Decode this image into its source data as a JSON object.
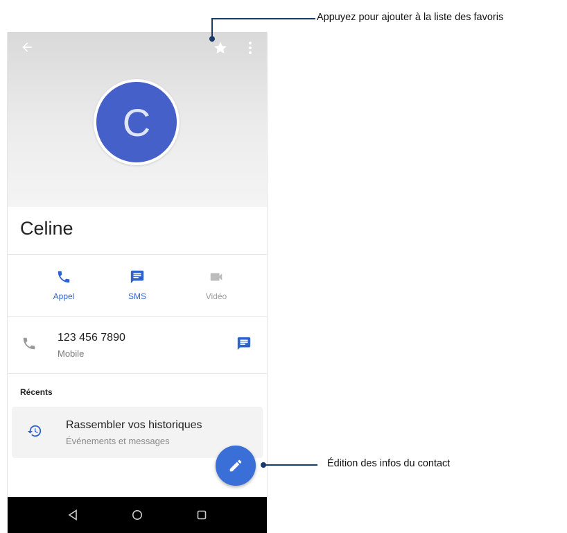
{
  "contact": {
    "avatar_letter": "C",
    "name": "Celine"
  },
  "actions": [
    {
      "label": "Appel",
      "icon": "phone-icon"
    },
    {
      "label": "SMS",
      "icon": "message-icon"
    },
    {
      "label": "Vidéo",
      "icon": "video-icon"
    }
  ],
  "phone": {
    "number": "123 456 7890",
    "type": "Mobile"
  },
  "recents": {
    "title": "Récents",
    "card_title": "Rassembler vos historiques",
    "card_subtitle": "Événements et messages"
  },
  "annotations": {
    "favorites": "Appuyez pour ajouter à la liste des favoris",
    "edit": "Édition des infos du contact"
  },
  "colors": {
    "accent": "#3b6fd8",
    "avatar": "#4560c8",
    "callout": "#1a3a6b"
  }
}
